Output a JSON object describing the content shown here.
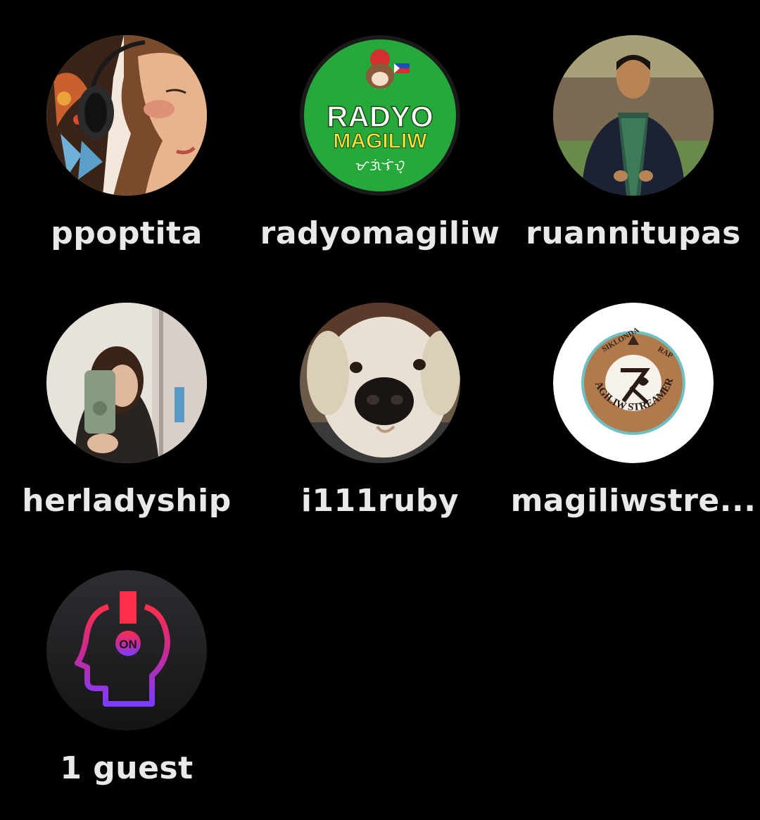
{
  "colors": {
    "background": "#000000",
    "name_text": "#e9e9e9"
  },
  "participants": [
    {
      "username": "ppoptita",
      "avatar": "woman-headphones-illustration"
    },
    {
      "username": "radyomagiliw",
      "avatar": "radyo-magiliw-logo",
      "logo_text": "RADYO",
      "logo_text2": "MAGILIW",
      "logo_script": "ᜋᜄᜒᜎᜒᜏ᜔"
    },
    {
      "username": "ruannitupas",
      "avatar": "man-in-coat-photo"
    },
    {
      "username": "herladyship",
      "avatar": "mirror-selfie-photo"
    },
    {
      "username": "i111ruby",
      "avatar": "golden-retriever-photo"
    },
    {
      "username": "magiliwstre...",
      "avatar": "magiliw-streamers-badge",
      "badge_text": "MAGILIW STREAMERS",
      "badge_top_left": "SIKLONDA",
      "badge_top_right": "RAP"
    },
    {
      "username": "1 guest",
      "avatar": "on-headphones-logo",
      "logo_text": "ON"
    }
  ]
}
